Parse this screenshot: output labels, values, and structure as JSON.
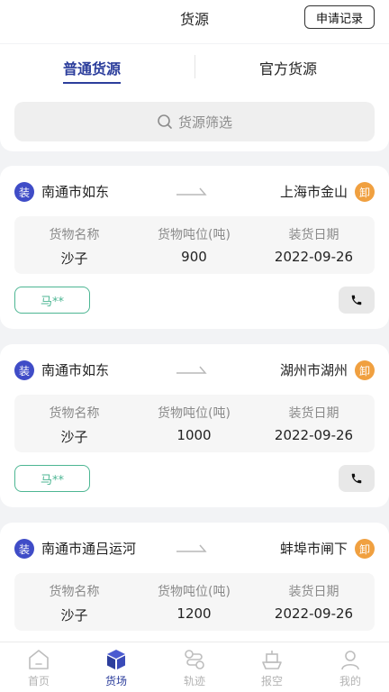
{
  "header": {
    "title": "货源",
    "apply_label": "申请记录"
  },
  "tabs": [
    {
      "label": "普通货源",
      "active": true
    },
    {
      "label": "官方货源",
      "active": false
    }
  ],
  "search": {
    "placeholder": "货源筛选"
  },
  "columns": {
    "cargo_name": "货物名称",
    "tonnage": "货物吨位(吨)",
    "date": "装货日期"
  },
  "badges": {
    "load": "装",
    "unload": "卸"
  },
  "cards": [
    {
      "origin": "南通市如东",
      "destination": "上海市金山",
      "cargo": "沙子",
      "tonnage": "900",
      "date": "2022-09-26",
      "contact": "马**"
    },
    {
      "origin": "南通市如东",
      "destination": "湖州市湖州",
      "cargo": "沙子",
      "tonnage": "1000",
      "date": "2022-09-26",
      "contact": "马**"
    },
    {
      "origin": "南通市通吕运河",
      "destination": "蚌埠市闸下",
      "cargo": "沙子",
      "tonnage": "1200",
      "date": "2022-09-26"
    }
  ],
  "tabbar": [
    {
      "label": "首页",
      "icon": "home-icon"
    },
    {
      "label": "货场",
      "icon": "cube-icon",
      "active": true
    },
    {
      "label": "轨迹",
      "icon": "route-icon"
    },
    {
      "label": "报空",
      "icon": "ship-icon"
    },
    {
      "label": "我的",
      "icon": "user-icon"
    }
  ],
  "colors": {
    "primary": "#2c3e9c",
    "load_badge": "#3f4cc7",
    "unload_badge": "#f0a040",
    "contact": "#4db693"
  }
}
